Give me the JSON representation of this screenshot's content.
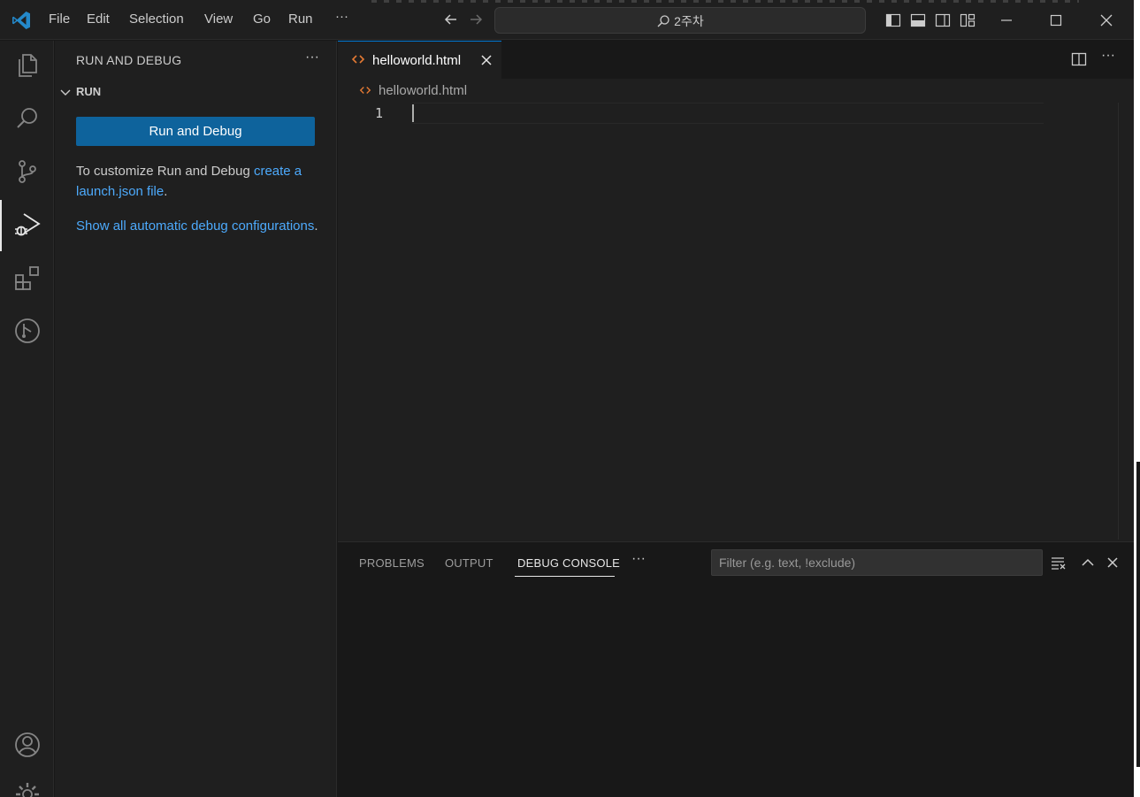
{
  "titlebar": {
    "menu": [
      "File",
      "Edit",
      "Selection",
      "View",
      "Go",
      "Run"
    ],
    "menu_more": "···",
    "search_text": "2주차"
  },
  "sidebar": {
    "title": "RUN AND DEBUG",
    "more": "···",
    "section": "RUN",
    "run_button": "Run and Debug",
    "customize_text": "To customize Run and Debug ",
    "customize_link": "create a launch.json file",
    "customize_end": ".",
    "show_link": "Show all automatic debug configurations",
    "show_end": "."
  },
  "editor": {
    "tab_label": "helloworld.html",
    "breadcrumb": "helloworld.html",
    "line_number": "1",
    "more": "···"
  },
  "panel": {
    "tabs": [
      "PROBLEMS",
      "OUTPUT",
      "DEBUG CONSOLE"
    ],
    "active_tab": "DEBUG CONSOLE",
    "more": "···",
    "filter_placeholder": "Filter (e.g. text, !exclude)"
  },
  "colors": {
    "accent": "#0078d4",
    "button": "#0e639c",
    "link": "#4daafc",
    "html_icon": "#e37933"
  }
}
